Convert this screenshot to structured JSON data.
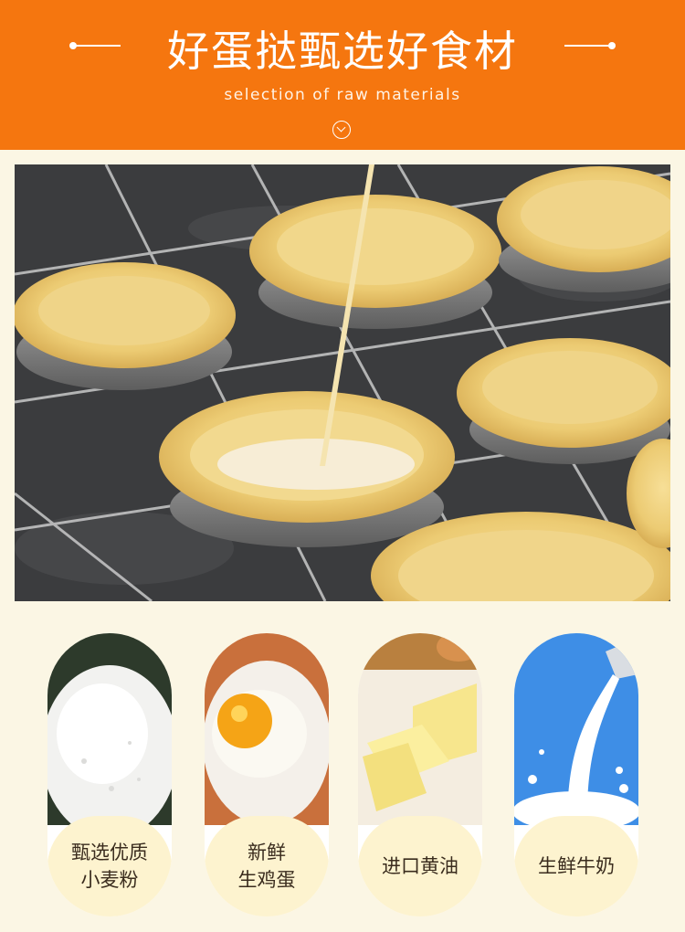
{
  "header": {
    "title": "好蛋挞甄选好食材",
    "subtitle": "selection of raw materials",
    "scroll_icon": "chevron-down-circle-icon",
    "accent_color": "#f5760f"
  },
  "hero_photo": {
    "subject": "egg-tart-shells-being-filled"
  },
  "ingredients": [
    {
      "label": "甄选优质\n小麦粉",
      "icon": "flour-photo"
    },
    {
      "label": "新鲜\n生鸡蛋",
      "icon": "egg-photo"
    },
    {
      "label": "进口黄油",
      "icon": "butter-photo"
    },
    {
      "label": "生鲜牛奶",
      "icon": "milk-photo"
    }
  ]
}
